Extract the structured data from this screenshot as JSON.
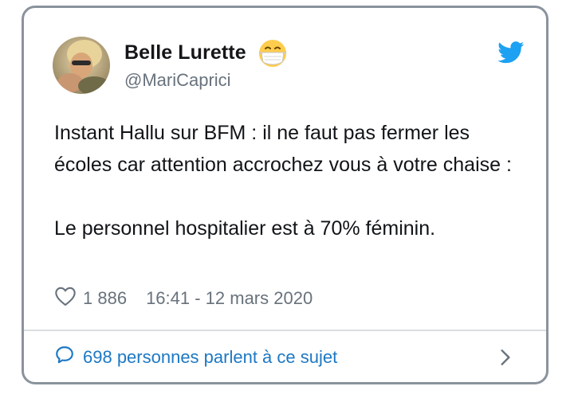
{
  "tweet": {
    "author": {
      "display_name": "Belle Lurette",
      "emoji": "face-with-medical-mask-icon",
      "handle": "@MariCaprici"
    },
    "text": {
      "line1": "Instant Hallu sur BFM : il ne faut pas fermer les écoles car attention accrochez vous à votre chaise :",
      "line2": "Le personnel hospitalier est à 70% féminin."
    },
    "likes": "1 886",
    "timestamp": "16:41 - 12 mars 2020",
    "conversation_label": "698 personnes parlent à ce sujet"
  },
  "colors": {
    "accent": "#1d78c4",
    "twitter_blue": "#1da1f2",
    "muted_text": "#68727c",
    "border": "#8a939d"
  }
}
